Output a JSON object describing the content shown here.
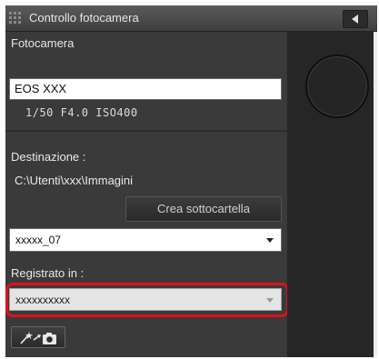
{
  "window": {
    "title": "Controllo fotocamera"
  },
  "camera": {
    "label": "Fotocamera",
    "model": "EOS XXX",
    "settings": "1/50  F4.0  ISO400"
  },
  "destination": {
    "label": "Destinazione :",
    "path": "C:\\Utenti\\xxx\\Immagini",
    "create_folder_button": "Crea sottocartella",
    "folder_select_value": "xxxxx_07"
  },
  "saved_in": {
    "label": "Registrato in :",
    "select_value": "xxxxxxxxxx"
  },
  "icons": {
    "grip": "grip-icon",
    "collapse": "collapse-arrow-icon",
    "wand_to_camera": "wand-to-camera-icon"
  },
  "colors": {
    "panel_bg": "#3a3a3a",
    "highlight": "#e0101a"
  }
}
